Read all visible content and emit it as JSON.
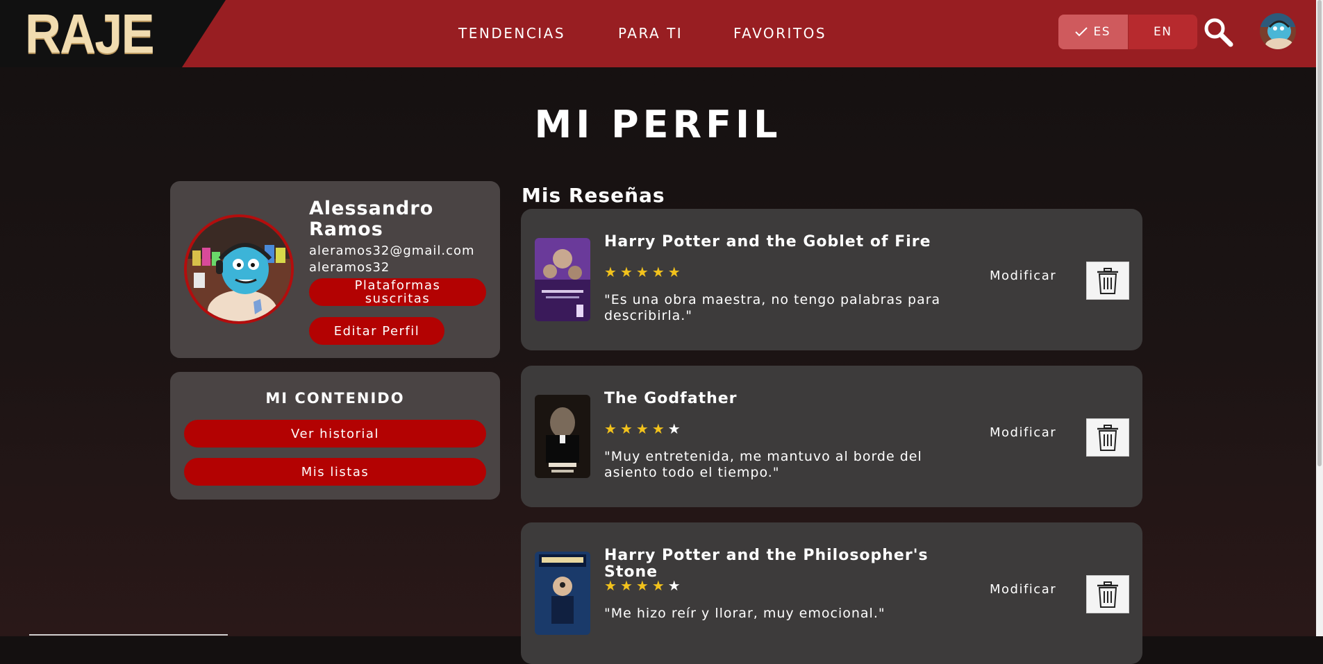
{
  "header": {
    "logo": "RAJE",
    "nav": [
      "TENDENCIAS",
      "PARA TI",
      "FAVORITOS"
    ],
    "languages": [
      {
        "code": "ES",
        "active": true
      },
      {
        "code": "EN",
        "active": false
      }
    ],
    "colors": {
      "header_bg": "#981e22",
      "accent_red": "#b30202"
    }
  },
  "page": {
    "title": "MI PERFIL"
  },
  "profile": {
    "name": "Alessandro Ramos",
    "email": "aleramos32@gmail.com",
    "username": "aleramos32",
    "platforms_button": "Plataformas suscritas",
    "edit_button": "Editar Perfil"
  },
  "content": {
    "title": "MI CONTENIDO",
    "history_button": "Ver historial",
    "lists_button": "Mis listas"
  },
  "reviews": {
    "section_title": "Mis Reseñas",
    "modify_label": "Modificar",
    "items": [
      {
        "title": "Harry Potter and the Goblet of Fire",
        "rating": 5,
        "max_rating": 5,
        "text": "\"Es una obra maestra, no tengo palabras para describirla.\""
      },
      {
        "title": "The Godfather",
        "rating": 4,
        "max_rating": 5,
        "text": "\"Muy entretenida, me mantuvo al borde del asiento todo el tiempo.\""
      },
      {
        "title": "Harry Potter and the Philosopher's Stone",
        "rating": 4,
        "max_rating": 5,
        "text": "\"Me hizo reír y llorar, muy emocional.\""
      }
    ]
  }
}
